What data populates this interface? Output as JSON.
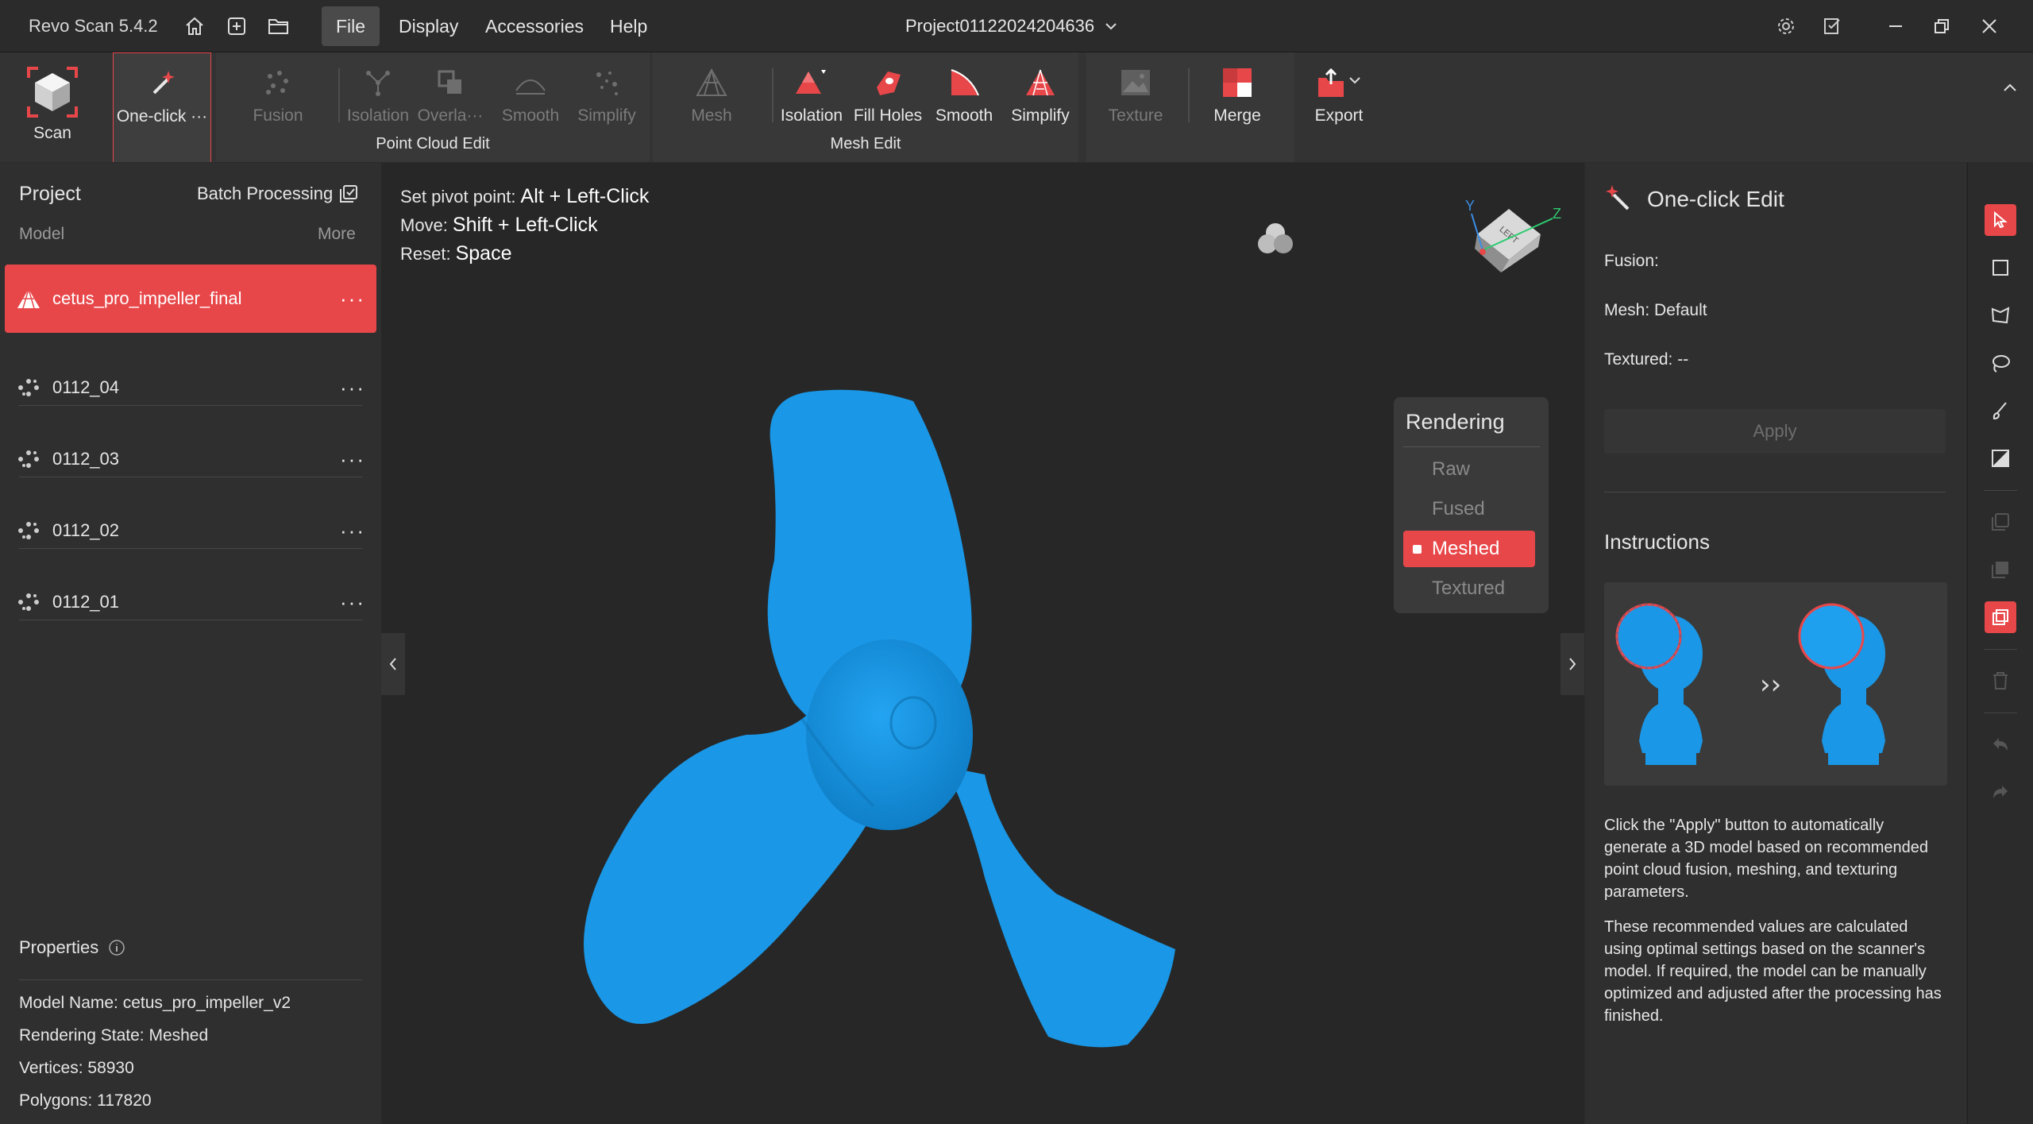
{
  "app": {
    "title": "Revo Scan 5.4.2"
  },
  "menu": [
    "File",
    "Display",
    "Accessories",
    "Help"
  ],
  "project_name": "Project01122024204636",
  "toolbar": {
    "scan": "Scan",
    "one_click": "One-click ···",
    "point_cloud": {
      "label": "Point Cloud Edit",
      "tools": [
        "Fusion",
        "Isolation",
        "Overla···",
        "Smooth",
        "Simplify"
      ]
    },
    "mesh_edit": {
      "label": "Mesh Edit",
      "tools": [
        "Mesh",
        "Isolation",
        "Fill Holes",
        "Smooth",
        "Simplify"
      ]
    },
    "texture": "Texture",
    "merge": "Merge",
    "export": "Export"
  },
  "left": {
    "title": "Project",
    "batch": "Batch Processing",
    "model_col": "Model",
    "more_col": "More",
    "models": [
      {
        "name": "cetus_pro_impeller_final",
        "more": "···"
      },
      {
        "name": "0112_04",
        "more": "···"
      },
      {
        "name": "0112_03",
        "more": "···"
      },
      {
        "name": "0112_02",
        "more": "···"
      },
      {
        "name": "0112_01",
        "more": "···"
      }
    ],
    "properties_title": "Properties",
    "properties": [
      {
        "key": "Model Name:",
        "value": "cetus_pro_impeller_v2"
      },
      {
        "key": "Rendering State:",
        "value": "Meshed"
      },
      {
        "key": "Vertices:",
        "value": "58930"
      },
      {
        "key": "Polygons:",
        "value": "117820"
      }
    ]
  },
  "viewport": {
    "hints": [
      {
        "label": "Set pivot point:",
        "keys": "Alt + Left-Click"
      },
      {
        "label": "Move:",
        "keys": "Shift + Left-Click"
      },
      {
        "label": "Reset:",
        "keys": "Space"
      }
    ],
    "gizmo": {
      "face": "LEFT",
      "y": "Y",
      "z": "Z"
    },
    "rendering": {
      "title": "Rendering",
      "options": [
        "Raw",
        "Fused",
        "Meshed",
        "Textured"
      ],
      "selected": "Meshed"
    },
    "model_color": "#1a97e6"
  },
  "right": {
    "title": "One-click Edit",
    "fusion": {
      "label": "Fusion:",
      "value": ""
    },
    "mesh": {
      "label": "Mesh:",
      "value": "Default"
    },
    "textured": {
      "label": "Textured:",
      "value": "--"
    },
    "apply": "Apply",
    "instructions_title": "Instructions",
    "paragraph1": "Click the \"Apply\" button to automatically generate a 3D model based on recommended point cloud fusion, meshing, and texturing parameters.",
    "paragraph2": "These recommended values are calculated using optimal settings based on the scanner's model. If required, the model can be manually optimized and adjusted after the processing has finished.",
    "arrow": "››"
  },
  "colors": {
    "accent": "#e8474a",
    "model": "#1a97e6",
    "panel": "#2f2f2f",
    "viewport": "#272727"
  }
}
